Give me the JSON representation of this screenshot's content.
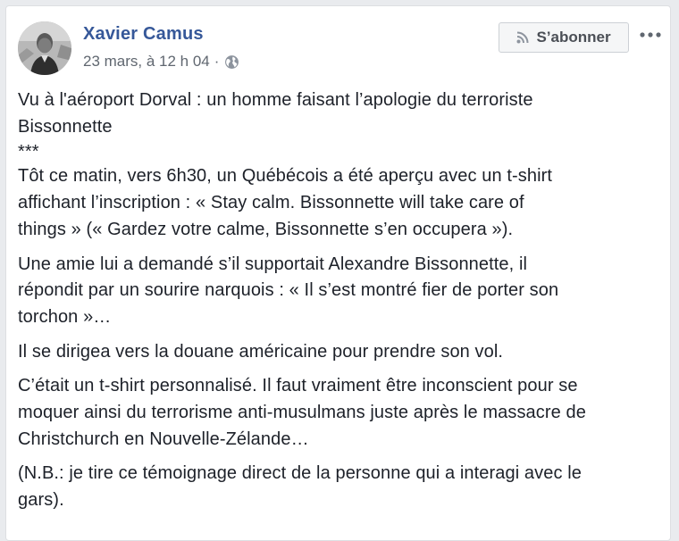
{
  "post": {
    "author": "Xavier Camus",
    "date": "23 mars, à 12 h 04",
    "meta_separator": "·",
    "audience_icon": "globe-icon",
    "follow_label": "S’abonner",
    "follow_icon": "rss-icon",
    "more_icon": "more-options-icon",
    "accent_color": "#365899",
    "paragraphs": [
      [
        "Vu à l'aéroport Dorval : un homme faisant l’apologie du terroriste",
        "Bissonnette"
      ],
      [
        "***"
      ],
      [
        "Tôt ce matin, vers 6h30, un Québécois a été aperçu avec un t-shirt",
        "affichant l’inscription : « Stay calm. Bissonnette will take care of",
        "things » (« Gardez votre calme, Bissonnette s’en occupera »)."
      ],
      [
        "Une amie lui a demandé s’il supportait Alexandre Bissonnette, il",
        "répondit par un sourire narquois : « Il s’est montré fier de porter son",
        "torchon »…"
      ],
      [
        "Il se dirigea vers la douane américaine pour prendre son vol."
      ],
      [
        "C’était un t-shirt personnalisé. Il faut vraiment être inconscient pour se",
        "moquer ainsi du terrorisme anti-musulmans juste après le massacre de",
        "Christchurch en Nouvelle-Zélande…"
      ],
      [
        "(N.B.: je tire ce témoignage direct de la personne qui a interagi avec le",
        "gars)."
      ]
    ]
  }
}
